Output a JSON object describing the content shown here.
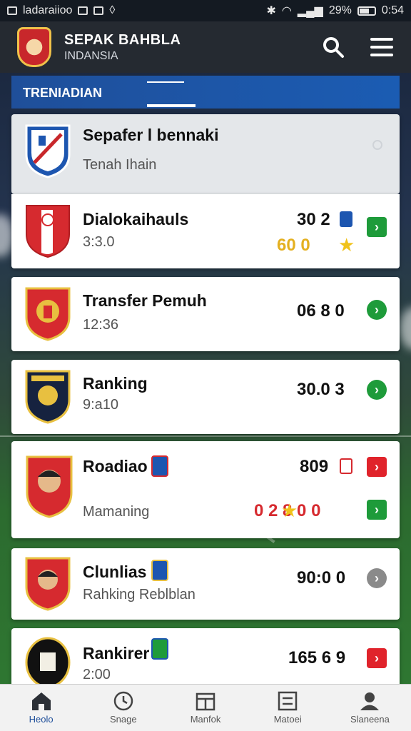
{
  "status_bar": {
    "left_text": "ladaraiioo",
    "battery_text": "29%",
    "time_text": "0:54"
  },
  "app": {
    "title": "SEPAK BAHBLA",
    "subtitle": "INDANSIA"
  },
  "tab": {
    "label": "TRENIADIAN"
  },
  "header_card": {
    "title": "Sepafer l bennaki",
    "subtitle": "Tenah Ihain"
  },
  "items": [
    {
      "title": "Dialokaihauls",
      "time": "3:3.0",
      "score": "30 2",
      "extra": "60 0",
      "arrow": "green"
    },
    {
      "title": "Transfer Pemuh",
      "time": "12:36",
      "score": "06 8 0",
      "arrow": "green-round"
    },
    {
      "title": "Ranking",
      "time": "9:a10",
      "score": "30.0 3",
      "arrow": "green-round"
    },
    {
      "title": "Roadiao",
      "time": "Mamaning",
      "score": "809",
      "extra": "0 2 8 0 0",
      "arrow": "red"
    },
    {
      "title": "Clunlias",
      "time": "Rahking Reblblan",
      "score": "90:0 0",
      "arrow": "grey"
    },
    {
      "title": "Rankirer",
      "time": "2:00",
      "score": "165 6 9",
      "arrow": "red"
    }
  ],
  "bottom_nav": [
    {
      "label": "Heolo",
      "icon": "home-icon"
    },
    {
      "label": "Snage",
      "icon": "clock-icon"
    },
    {
      "label": "Manfok",
      "icon": "box-icon"
    },
    {
      "label": "Matoei",
      "icon": "list-icon"
    },
    {
      "label": "Slaneena",
      "icon": "user-icon"
    }
  ],
  "colors": {
    "brand": "#1f4f9a",
    "appbar": "#252a31",
    "go_green": "#1e9b3a",
    "go_red": "#e0232b"
  }
}
